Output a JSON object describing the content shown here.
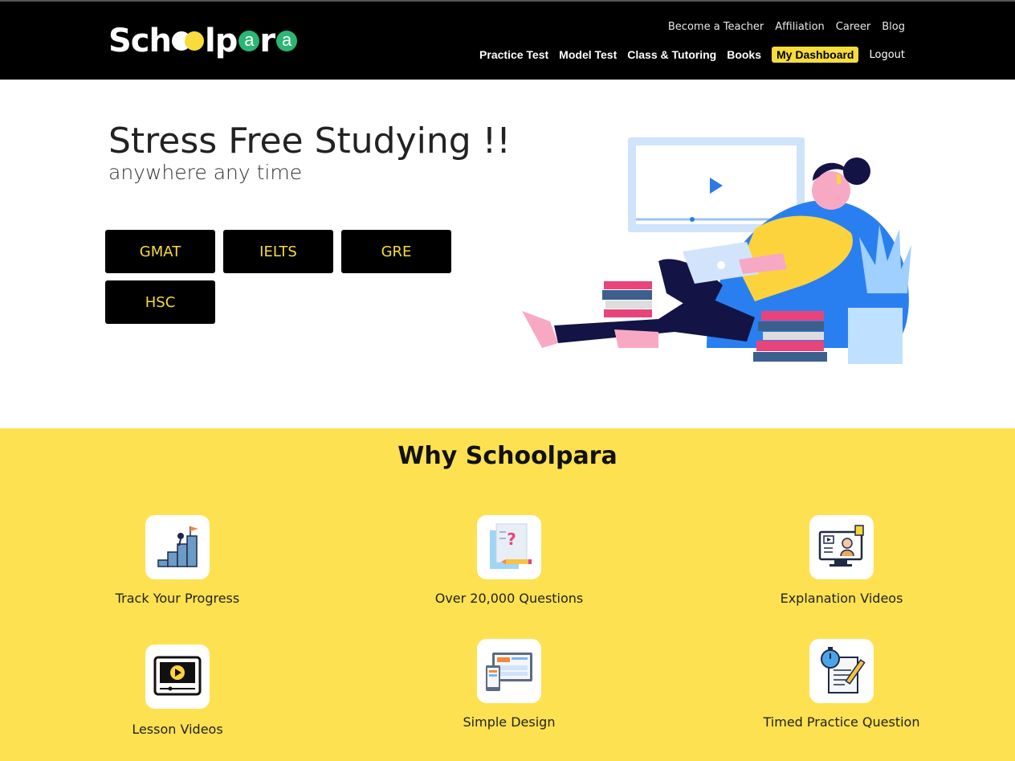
{
  "header": {
    "logo": "Schoolpara",
    "top_links": [
      "Become a Teacher",
      "Affiliation",
      "Career",
      "Blog"
    ],
    "nav": [
      "Practice Test",
      "Model Test",
      "Class & Tutoring",
      "Books"
    ],
    "dashboard": "My Dashboard",
    "logout": "Logout"
  },
  "hero": {
    "title": "Stress Free Studying !!",
    "subtitle": "anywhere any time",
    "exams": [
      "GMAT",
      "IELTS",
      "GRE",
      "HSC"
    ]
  },
  "why": {
    "title": "Why Schoolpara",
    "features": [
      {
        "label": "Track Your Progress",
        "icon": "progress-icon"
      },
      {
        "label": "Over 20,000 Questions",
        "icon": "questions-icon"
      },
      {
        "label": "Explanation Videos",
        "icon": "explanation-video-icon"
      },
      {
        "label": "Lesson Videos",
        "icon": "lesson-video-icon"
      },
      {
        "label": "Simple Design",
        "icon": "simple-design-icon"
      },
      {
        "label": "Timed Practice Question",
        "icon": "timer-icon"
      }
    ]
  },
  "colors": {
    "header_bg": "#000000",
    "accent_yellow": "#f7dc3b",
    "section_yellow": "#fde151",
    "logo_green": "#2bb673"
  }
}
